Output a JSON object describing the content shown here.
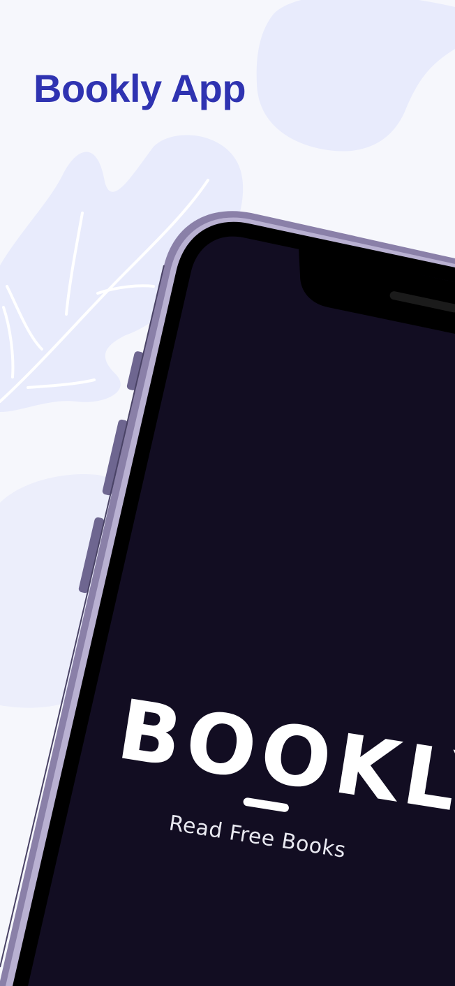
{
  "page": {
    "title": "Bookly App"
  },
  "screen": {
    "logo_text": "BOOKLY",
    "tagline": "Read Free Books"
  },
  "colors": {
    "title": "#2f33b1",
    "background": "#f6f7fc",
    "blob": "#e8ebfc",
    "screen": "#120d22",
    "frame": "#8a80a8",
    "bezel": "#000000"
  },
  "icons": {
    "leaf": "leaf-illustration",
    "notch": "phone-notch"
  }
}
